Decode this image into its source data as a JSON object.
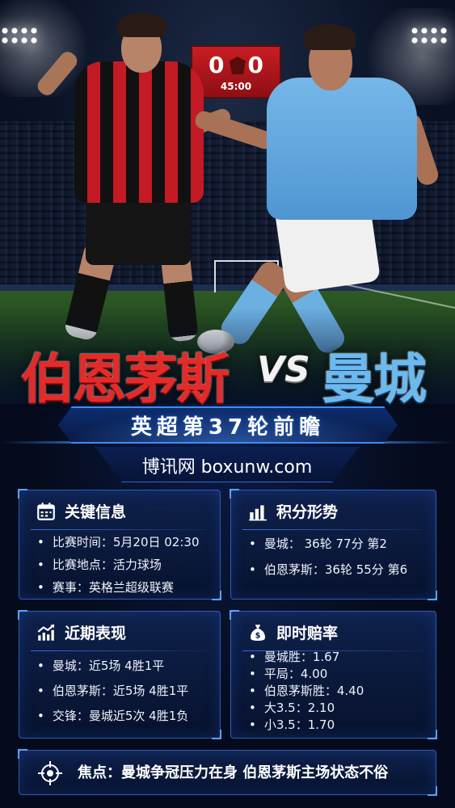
{
  "scoreboard": {
    "home_score": "0",
    "away_score": "0",
    "clock": "45:00"
  },
  "title": {
    "home": "伯恩茅斯",
    "vs": "VS",
    "away": "曼城"
  },
  "subtitle": "英超第37轮前瞻",
  "site": "博讯网 boxunw.com",
  "cards": {
    "info": {
      "title": "关键信息",
      "icon": "calendar-icon",
      "items": [
        "比赛时间：5月20日 02:30",
        "比赛地点：活力球场",
        "赛事：英格兰超级联赛"
      ]
    },
    "standing": {
      "title": "积分形势",
      "icon": "bar-chart-icon",
      "items": [
        "曼城：  36轮  77分  第2",
        "伯恩茅斯：36轮  55分  第6"
      ]
    },
    "form": {
      "title": "近期表现",
      "icon": "trend-chart-icon",
      "items": [
        "曼城：近5场  4胜1平",
        "伯恩茅斯：近5场  4胜1平",
        "交锋：曼城近5次  4胜1负"
      ]
    },
    "odds": {
      "title": "即时赔率",
      "icon": "money-bag-icon",
      "items": [
        "曼城胜：1.67",
        "平局：4.00",
        "伯恩茅斯胜：4.40",
        "大3.5：2.10",
        "小3.5：1.70"
      ]
    }
  },
  "focus": {
    "icon": "target-icon",
    "text": "焦点：曼城争冠压力在身 伯恩茅斯主场状态不俗"
  },
  "colors": {
    "home_red": "#e52a2a",
    "away_blue": "#6cb9ee",
    "accent": "#2d5cb4",
    "background": "#050b1c"
  }
}
